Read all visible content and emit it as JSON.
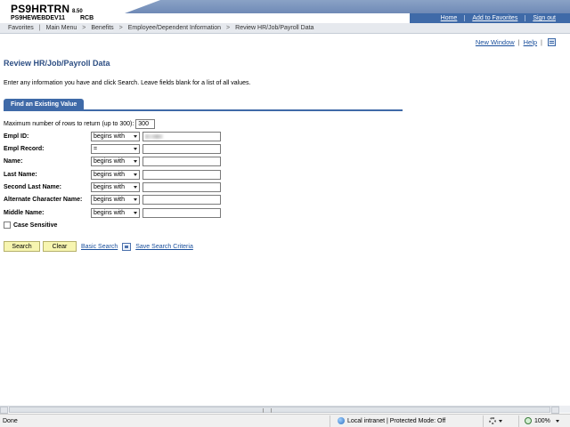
{
  "header": {
    "app_name": "PS9HRTRN",
    "version": "8.50",
    "server": "PS9HEWEBDEV11",
    "user": "RCB",
    "links": [
      "Home",
      "Add to Favorites",
      "Sign out"
    ]
  },
  "nav": {
    "items": [
      "Favorites",
      "Main Menu",
      "Benefits",
      "Employee/Dependent Information",
      "Review HR/Job/Payroll Data"
    ],
    "separator": ">"
  },
  "page_links": {
    "new_window": "New Window",
    "separator": "|",
    "help": "Help",
    "customize_icon": "customize-page-icon"
  },
  "page": {
    "title": "Review HR/Job/Payroll Data",
    "instructions": "Enter any information you have and click Search. Leave fields blank for a list of all values.",
    "tab_label": "Find an Existing Value"
  },
  "search": {
    "max_rows_label": "Maximum number of rows to return (up to 300):",
    "max_rows_value": "300",
    "fields": [
      {
        "label": "Empl ID:",
        "operator": "begins with",
        "value": ""
      },
      {
        "label": "Empl Record:",
        "operator": "=",
        "value": ""
      },
      {
        "label": "Name:",
        "operator": "begins with",
        "value": ""
      },
      {
        "label": "Last Name:",
        "operator": "begins with",
        "value": ""
      },
      {
        "label": "Second Last Name:",
        "operator": "begins with",
        "value": ""
      },
      {
        "label": "Alternate Character Name:",
        "operator": "begins with",
        "value": ""
      },
      {
        "label": "Middle Name:",
        "operator": "begins with",
        "value": ""
      }
    ],
    "case_sensitive_label": "Case Sensitive",
    "case_sensitive_checked": false
  },
  "actions": {
    "search": "Search",
    "clear": "Clear",
    "basic_search": "Basic Search",
    "save_criteria": "Save Search Criteria"
  },
  "statusbar": {
    "status": "Done",
    "zone": "Local intranet | Protected Mode: Off",
    "zoom": "100%"
  },
  "colors": {
    "accent": "#3f6aa8",
    "title": "#2e4f84",
    "button": "#f7f5b0",
    "link": "#1a4f9c"
  }
}
